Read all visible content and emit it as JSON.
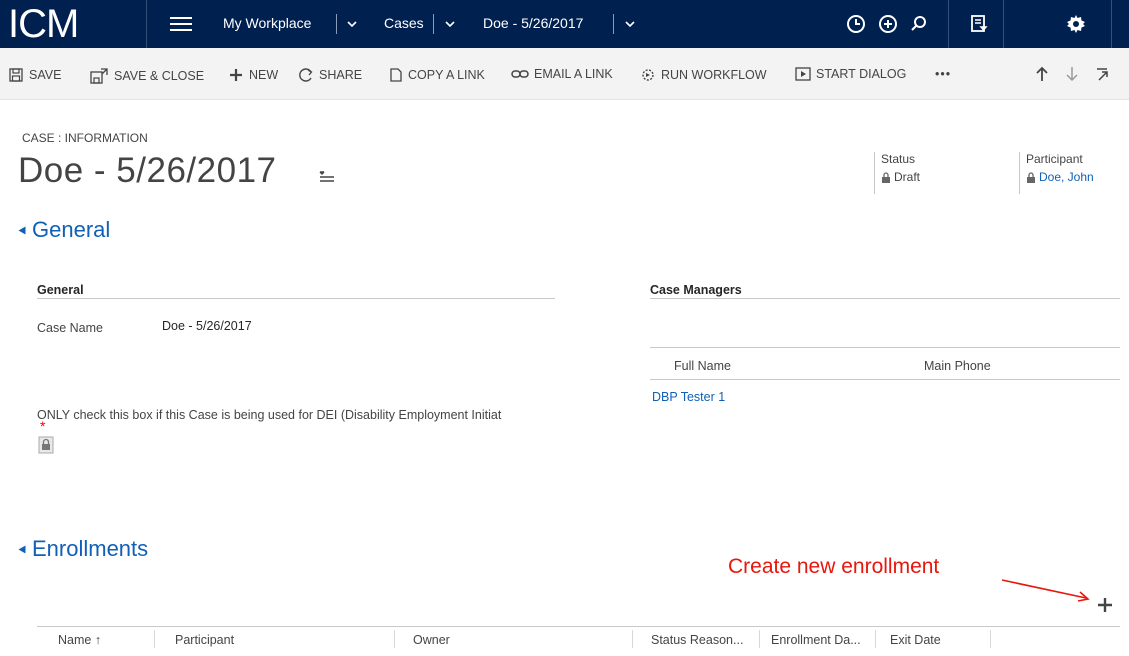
{
  "nav": {
    "logo": "ICM",
    "items": [
      "My Workplace",
      "Cases",
      "Doe - 5/26/2017"
    ],
    "icons": [
      "history-icon",
      "add-circle-icon",
      "search-icon",
      "advanced-find-icon",
      "settings-gear-icon"
    ]
  },
  "commands": {
    "save": "SAVE",
    "save_close": "SAVE & CLOSE",
    "new": "NEW",
    "share": "SHARE",
    "copy_link": "COPY A LINK",
    "email_link": "EMAIL A LINK",
    "run_workflow": "RUN WORKFLOW",
    "start_dialog": "START DIALOG",
    "more": "•••"
  },
  "header": {
    "breadcrumb": "CASE : INFORMATION",
    "title": "Doe - 5/26/2017",
    "status_label": "Status",
    "status_value": "Draft",
    "participant_label": "Participant",
    "participant_value": "Doe, John"
  },
  "general": {
    "section_title": "General",
    "subsection_title": "General",
    "case_name_label": "Case Name",
    "case_name_value": "Doe - 5/26/2017",
    "dei_label": "ONLY check this box if this Case is being used for DEI (Disability Employment Initiat",
    "required_marker": "*"
  },
  "case_managers": {
    "title": "Case Managers",
    "columns": [
      "Full Name",
      "Main Phone"
    ],
    "rows": [
      {
        "full_name": "DBP Tester 1"
      }
    ]
  },
  "enrollments": {
    "section_title": "Enrollments",
    "annotation": "Create new enrollment",
    "columns": [
      "Name ↑",
      "Participant",
      "Owner",
      "Status Reason...",
      "Enrollment Da...",
      "Exit Date"
    ]
  },
  "colors": {
    "nav_bg": "#002050",
    "link": "#1160b7",
    "annotation": "#e8160c"
  }
}
